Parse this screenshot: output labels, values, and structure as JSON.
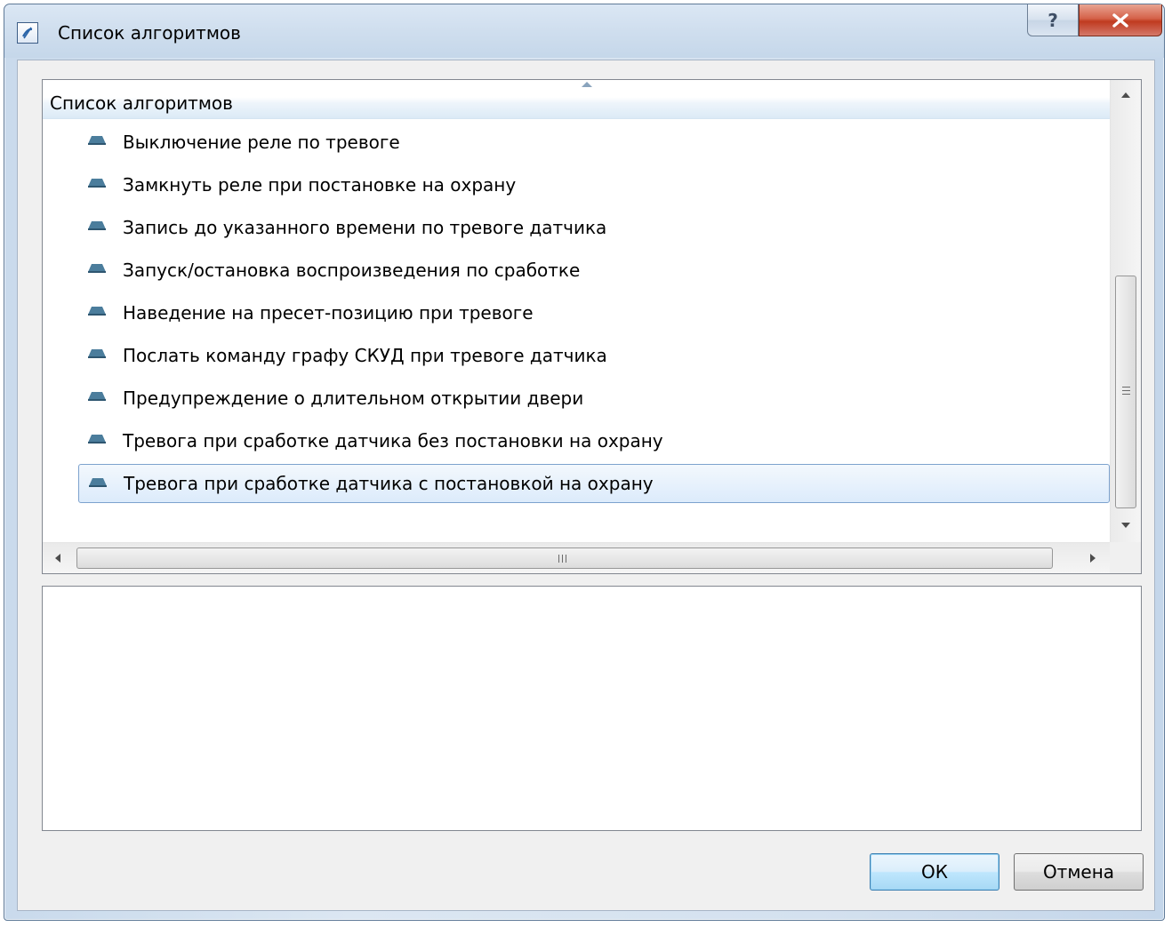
{
  "window": {
    "title": "Список алгоритмов",
    "help_glyph": "?"
  },
  "list": {
    "header": "Список алгоритмов",
    "selected_index": 8,
    "items": [
      {
        "label": "Выключение реле по тревоге"
      },
      {
        "label": "Замкнуть реле при постановке на охрану"
      },
      {
        "label": "Запись до указанного времени по тревоге датчика"
      },
      {
        "label": "Запуск/остановка воспроизведения по сработке"
      },
      {
        "label": "Наведение на пресет-позицию при тревоге"
      },
      {
        "label": "Послать команду графу СКУД при тревоге датчика"
      },
      {
        "label": "Предупреждение о длительном открытии двери"
      },
      {
        "label": "Тревога при сработке датчика без постановки на охрану"
      },
      {
        "label": "Тревога при сработке датчика с постановкой на охрану"
      }
    ]
  },
  "description": {
    "text": ""
  },
  "buttons": {
    "ok": "ОК",
    "cancel": "Отмена"
  },
  "colors": {
    "selection_border": "#7da2ce",
    "item_icon": "#4b7d9c"
  }
}
